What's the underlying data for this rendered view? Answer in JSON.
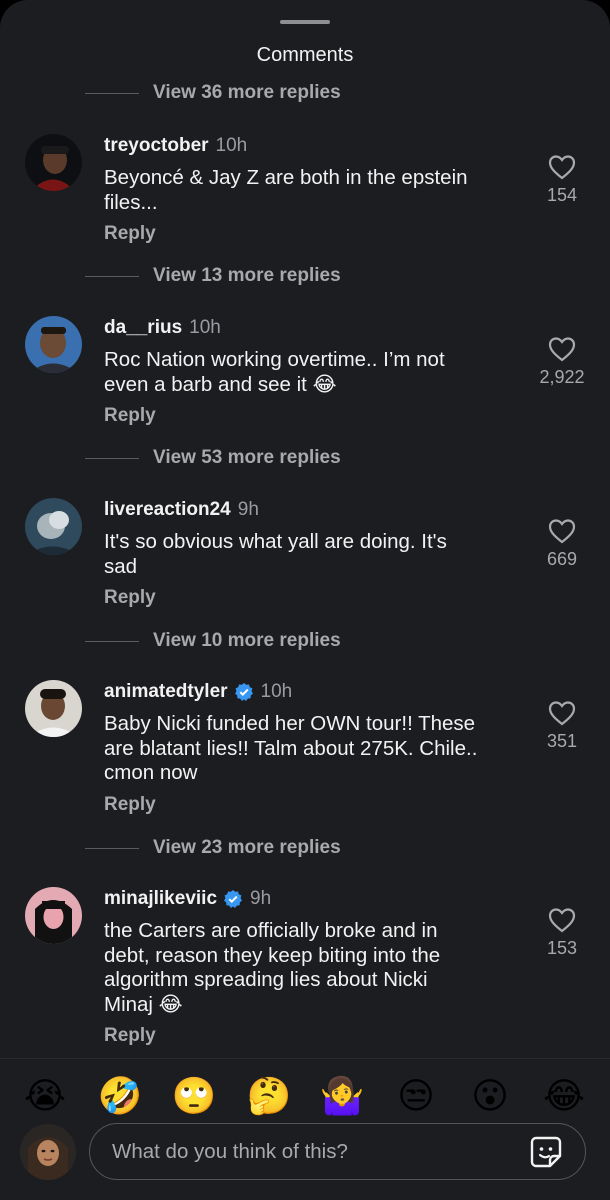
{
  "sheet": {
    "title": "Comments"
  },
  "replies_rows": [
    "View 36 more replies",
    "View 13 more replies",
    "View 53 more replies",
    "View 10 more replies",
    "View 23 more replies"
  ],
  "comments": [
    {
      "username": "treyoctober",
      "verified": false,
      "time": "10h",
      "text": "Beyoncé & Jay Z are both in the epstein\nfiles...",
      "reply_label": "Reply",
      "likes": "154",
      "avatar_icon": "profile-photo-icon"
    },
    {
      "username": "da__rius",
      "verified": false,
      "time": "10h",
      "text": "Roc Nation working overtime.. I’m not\neven a barb and see it 😂",
      "reply_label": "Reply",
      "likes": "2,922",
      "avatar_icon": "profile-photo-icon"
    },
    {
      "username": "livereaction24",
      "verified": false,
      "time": "9h",
      "text": "It's so obvious what yall are doing.  It's\nsad",
      "reply_label": "Reply",
      "likes": "669",
      "avatar_icon": "profile-photo-icon"
    },
    {
      "username": "animatedtyler",
      "verified": true,
      "time": "10h",
      "text": "Baby Nicki funded her OWN tour!! These\nare blatant lies!! Talm about 275K. Chile..\ncmon now",
      "reply_label": "Reply",
      "likes": "351",
      "avatar_icon": "profile-photo-icon"
    },
    {
      "username": "minajlikeviic",
      "verified": true,
      "time": "9h",
      "text": "the Carters are officially broke and in\ndebt, reason they keep biting into the\nalgorithm spreading lies about Nicki\nMinaj 😂",
      "reply_label": "Reply",
      "likes": "153",
      "avatar_icon": "profile-photo-icon"
    }
  ],
  "emoji_bar": [
    "😭",
    "🤣",
    "🙄",
    "🤔",
    "🤷‍♀️",
    "😒",
    "😮",
    "😂"
  ],
  "composer": {
    "placeholder": "What do you think of this?",
    "sticker_icon": "sticker-icon"
  },
  "colors": {
    "sheet_bg": "#1c1d21",
    "text_primary": "#f2f2f2",
    "text_secondary": "#a8a9ad",
    "verified_blue": "#3897f0"
  }
}
